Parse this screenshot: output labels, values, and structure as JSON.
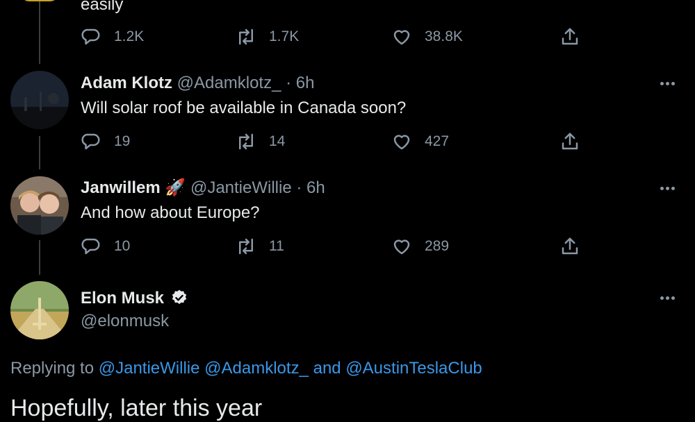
{
  "top_tweet": {
    "text_fragment": "easily",
    "actions": {
      "replies": "1.2K",
      "retweets": "1.7K",
      "likes": "38.8K"
    }
  },
  "replies": [
    {
      "name": "Adam Klotz",
      "handle": "@Adamklotz_",
      "time": "· 6h",
      "text": "Will solar roof be available in Canada soon?",
      "actions": {
        "replies": "19",
        "retweets": "14",
        "likes": "427"
      }
    },
    {
      "name": "Janwillem",
      "emoji": "🚀",
      "handle": "@JantieWillie",
      "time": "· 6h",
      "text": "And how about Europe?",
      "actions": {
        "replies": "10",
        "retweets": "11",
        "likes": "289"
      }
    }
  ],
  "main_tweet": {
    "name": "Elon Musk",
    "handle": "@elonmusk",
    "replying_prefix": "Replying to",
    "mention_1": "@JantieWillie",
    "mention_2": "@Adamklotz_",
    "and_word": "and",
    "mention_3": "@AustinTeslaClub",
    "text": "Hopefully, later this year"
  },
  "icons": {
    "reply": "reply-icon",
    "retweet": "retweet-icon",
    "like": "heart-icon",
    "share": "share-icon",
    "more": "more-options-icon",
    "verified": "verified-badge-icon"
  },
  "colors": {
    "background": "#000000",
    "text": "#e7e9ea",
    "muted": "#8b98a5",
    "link": "#3a97e8",
    "verified_badge": "#e7e9ea"
  }
}
